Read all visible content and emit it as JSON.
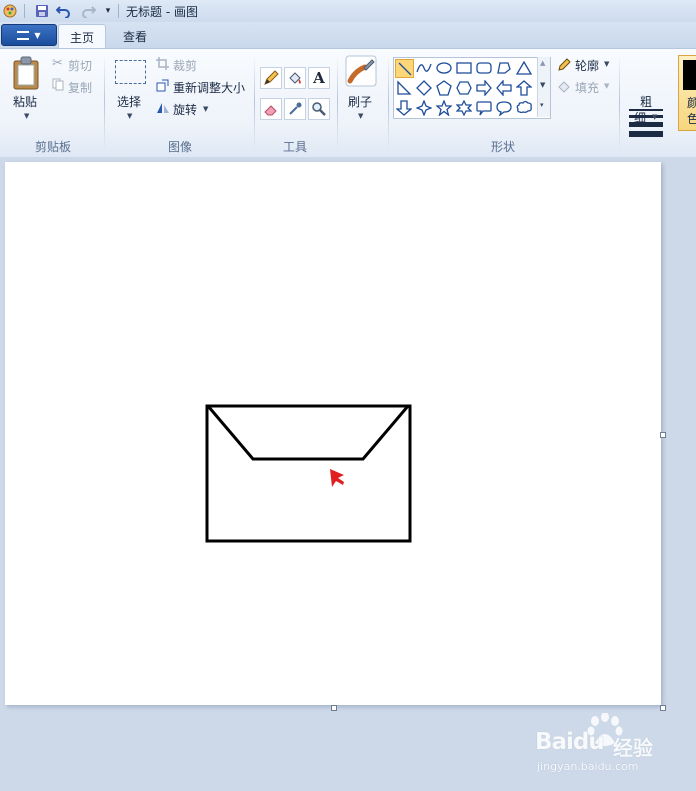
{
  "titlebar": {
    "title": "无标题 - 画图",
    "quick_access": [
      "save-icon",
      "undo-icon",
      "redo-icon",
      "customize-icon"
    ]
  },
  "tabs": {
    "file_icon": "menu-icon",
    "home": "主页",
    "view": "查看"
  },
  "clipboard": {
    "paste": "粘贴",
    "cut": "剪切",
    "copy": "复制",
    "group": "剪贴板"
  },
  "image": {
    "select": "选择",
    "crop": "裁剪",
    "resize": "重新调整大小",
    "rotate": "旋转",
    "group": "图像"
  },
  "tools": {
    "group": "工具",
    "items": [
      "pencil-icon",
      "fill-icon",
      "text-icon",
      "eraser-icon",
      "color-picker-icon",
      "magnifier-icon"
    ]
  },
  "brushes": {
    "label": "刷子"
  },
  "shapes": {
    "group": "形状",
    "outline": "轮廓",
    "fill": "填充",
    "items": [
      "line",
      "curve",
      "oval",
      "rectangle",
      "rounded-rectangle",
      "polygon",
      "triangle",
      "right-triangle",
      "diamond",
      "pentagon",
      "hexagon",
      "right-arrow",
      "left-arrow",
      "up-arrow",
      "down-arrow",
      "four-point-star",
      "five-point-star",
      "six-point-star",
      "rounded-callout",
      "oval-callout",
      "cloud-callout"
    ],
    "selected": "line"
  },
  "size": {
    "label_1": "粗",
    "label_2": "细"
  },
  "colors": {
    "label_1": "颜",
    "label_2": "色",
    "color1": "#000000"
  },
  "drawing": {
    "stroke": "#000000",
    "cursor_color": "#e02020"
  },
  "watermark": {
    "brand": "Baidu",
    "cn": "经验",
    "url": "jingyan.baidu.com"
  }
}
